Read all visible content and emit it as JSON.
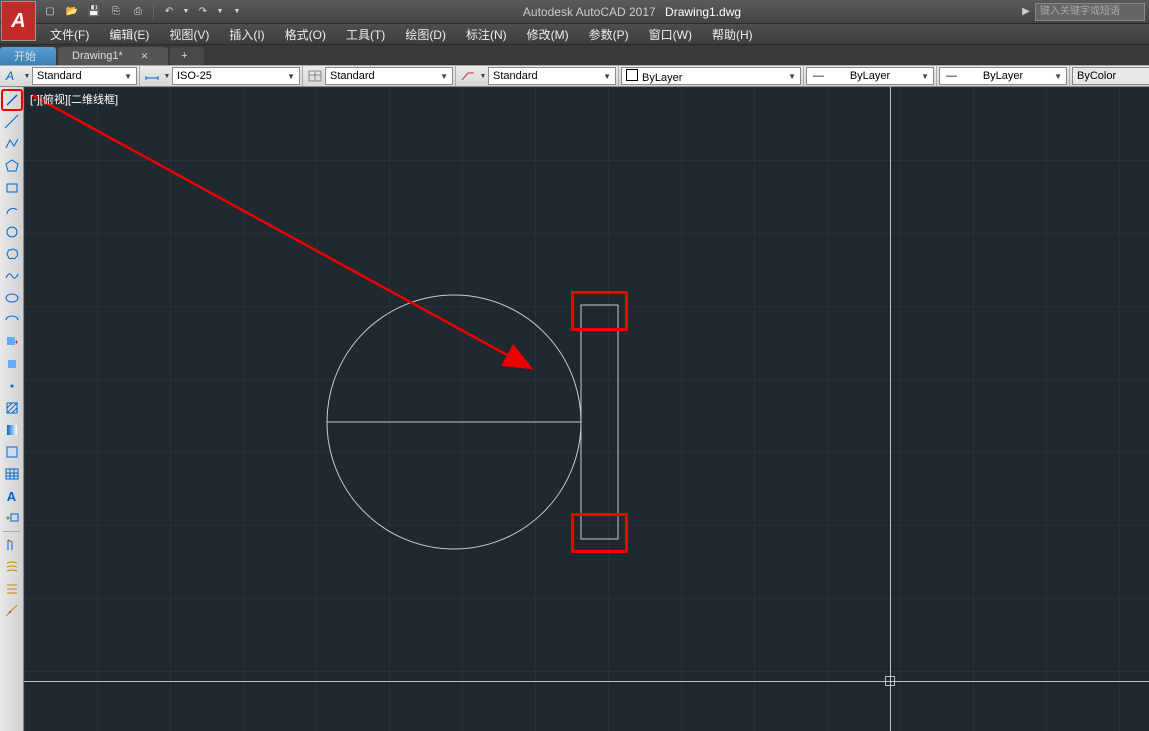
{
  "title": {
    "app": "Autodesk AutoCAD 2017",
    "file": "Drawing1.dwg"
  },
  "search_placeholder": "键入关键字或短语",
  "menus": [
    "文件(F)",
    "编辑(E)",
    "视图(V)",
    "插入(I)",
    "格式(O)",
    "工具(T)",
    "绘图(D)",
    "标注(N)",
    "修改(M)",
    "参数(P)",
    "窗口(W)",
    "帮助(H)"
  ],
  "tabs": {
    "start": "开始",
    "doc": "Drawing1*",
    "add": "+"
  },
  "props": {
    "textstyle": "Standard",
    "dimstyle": "ISO-25",
    "tablestyle": "Standard",
    "mleaderstyle": "Standard",
    "layercolor": "ByLayer",
    "lineweight": "ByLayer",
    "linetype": "ByLayer",
    "plotcolor": "ByColor"
  },
  "viewport_label": "[-][俯视][二维线框]",
  "tool_names": [
    "line",
    "xline",
    "polyline",
    "polygon",
    "rectangle",
    "arc",
    "circle",
    "revcloud",
    "spline",
    "ellipse",
    "ellipse-arc",
    "insert",
    "block",
    "point",
    "hatch",
    "gradient",
    "region",
    "table",
    "text",
    "addselected",
    "mirror",
    "offset",
    "array",
    "dim"
  ]
}
